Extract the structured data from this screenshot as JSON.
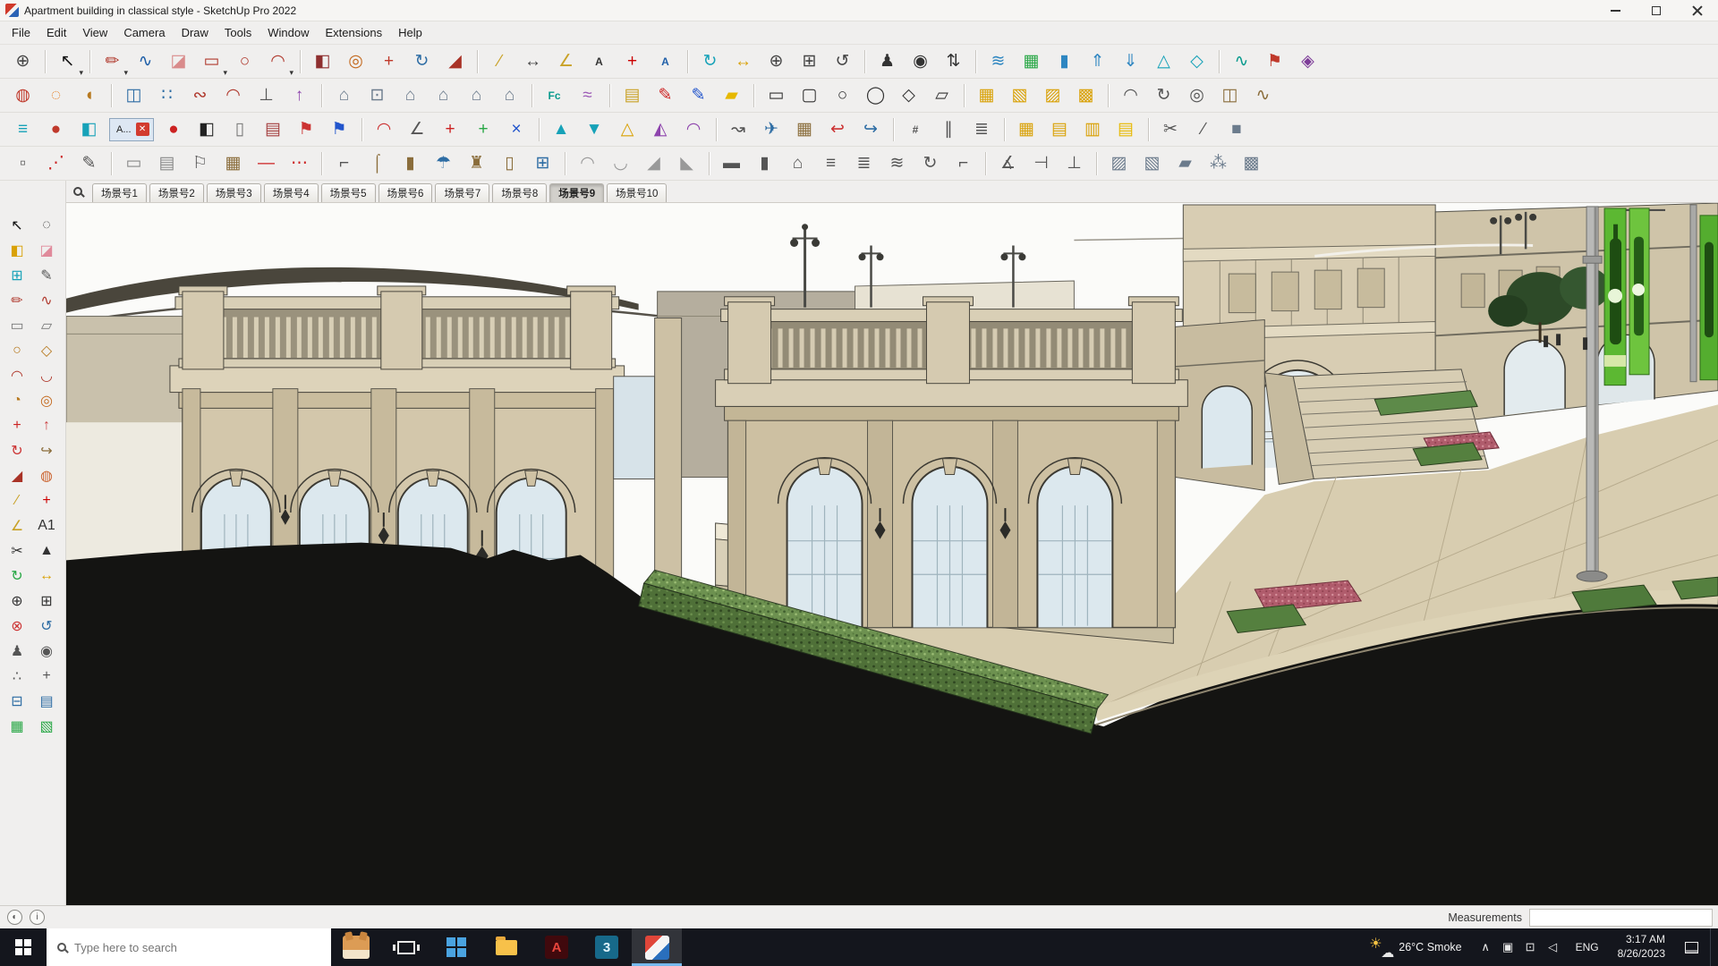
{
  "window": {
    "title": "Apartment building in classical style - SketchUp Pro 2022"
  },
  "glyphs": {
    "dropdown": "▾"
  },
  "colors": {
    "active_accent": "#76b9ed",
    "taskbar_bg": "#14161d"
  },
  "menu": {
    "items": [
      {
        "n": "menu-file",
        "label": "File"
      },
      {
        "n": "menu-edit",
        "label": "Edit"
      },
      {
        "n": "menu-view",
        "label": "View"
      },
      {
        "n": "menu-camera",
        "label": "Camera"
      },
      {
        "n": "menu-draw",
        "label": "Draw"
      },
      {
        "n": "menu-tools",
        "label": "Tools"
      },
      {
        "n": "menu-window",
        "label": "Window"
      },
      {
        "n": "menu-extensions",
        "label": "Extensions"
      },
      {
        "n": "menu-help",
        "label": "Help"
      }
    ]
  },
  "toolbars": {
    "mini_window": {
      "label": "A...",
      "close_glyph": "✕"
    },
    "row1": [
      {
        "n": "zoom-extents-tool",
        "g": "⊕",
        "c": "#444444"
      },
      {
        "sep": true
      },
      {
        "n": "select-tool",
        "g": "↖",
        "c": "#111111",
        "d": true
      },
      {
        "sep": true
      },
      {
        "n": "line-tool",
        "g": "✏",
        "c": "#b03a2e",
        "d": true
      },
      {
        "n": "freehand-tool",
        "g": "∿",
        "c": "#1f5fa8"
      },
      {
        "n": "eraser-tool",
        "g": "◪",
        "c": "#d98b8b"
      },
      {
        "n": "rectangle-tool",
        "g": "▭",
        "c": "#b03a2e",
        "d": true
      },
      {
        "n": "circle-tool",
        "g": "○",
        "c": "#b03a2e"
      },
      {
        "n": "arc-tool",
        "g": "◠",
        "c": "#b03a2e",
        "d": true
      },
      {
        "sep": true
      },
      {
        "n": "push-pull-tool",
        "g": "◧",
        "c": "#8e2f2f"
      },
      {
        "n": "offset-tool",
        "g": "◎",
        "c": "#c46a1f"
      },
      {
        "n": "move-tool",
        "g": "+",
        "c": "#c0392b"
      },
      {
        "n": "rotate-tool",
        "g": "↻",
        "c": "#2e6da4"
      },
      {
        "n": "scale-tool",
        "g": "◢",
        "c": "#a93226"
      },
      {
        "sep": true
      },
      {
        "n": "tape-measure-tool",
        "g": "∕",
        "c": "#c9a227"
      },
      {
        "n": "dimension-tool",
        "g": "↔",
        "c": "#444444"
      },
      {
        "n": "protractor-tool",
        "g": "∠",
        "c": "#c9a227"
      },
      {
        "n": "text-tool",
        "g": "A",
        "c": "#333333",
        "text": true
      },
      {
        "n": "axes-tool",
        "g": "+",
        "c": "#cc0000"
      },
      {
        "n": "3d-text-tool",
        "g": "A",
        "c": "#1f5fa8",
        "text": true
      },
      {
        "sep": true
      },
      {
        "n": "orbit-tool",
        "g": "↻",
        "c": "#17a2b8"
      },
      {
        "n": "pan-tool",
        "g": "↔",
        "c": "#d9a106"
      },
      {
        "n": "zoom-tool",
        "g": "⊕",
        "c": "#444444"
      },
      {
        "n": "zoom-window-tool",
        "g": "⊞",
        "c": "#444444"
      },
      {
        "n": "previous-view-tool",
        "g": "↺",
        "c": "#444444"
      },
      {
        "sep": true
      },
      {
        "n": "position-camera-tool",
        "g": "♟",
        "c": "#333333"
      },
      {
        "n": "look-around-tool",
        "g": "◉",
        "c": "#333333"
      },
      {
        "n": "walk-tool",
        "g": "⇅",
        "c": "#333333"
      },
      {
        "sep": true
      },
      {
        "n": "sandbox-from-contours-tool",
        "g": "≋",
        "c": "#2e86c1"
      },
      {
        "n": "sandbox-from-scratch-tool",
        "g": "▦",
        "c": "#28a745"
      },
      {
        "n": "smoove-tool",
        "g": "▮",
        "c": "#2e86c1"
      },
      {
        "n": "stamp-tool",
        "g": "⇑",
        "c": "#2e86c1"
      },
      {
        "n": "drape-tool",
        "g": "⇓",
        "c": "#2e86c1"
      },
      {
        "n": "add-detail-tool",
        "g": "△",
        "c": "#17a2b8"
      },
      {
        "n": "flip-edge-tool",
        "g": "◇",
        "c": "#17a2b8"
      },
      {
        "sep": true
      },
      {
        "n": "extension-wave-tool",
        "g": "∿",
        "c": "#0a9b8e"
      },
      {
        "n": "extension-flag-tool",
        "g": "⚑",
        "c": "#c0392b"
      },
      {
        "n": "extension-diamond-tool",
        "g": "◈",
        "c": "#7d3c98"
      }
    ],
    "row2": [
      {
        "n": "soap-skin-tool",
        "g": "◍",
        "c": "#c0392b"
      },
      {
        "n": "bubble-tool",
        "g": "◌",
        "c": "#e67e22"
      },
      {
        "n": "round-corner-tool",
        "g": "◖",
        "c": "#b7791f"
      },
      {
        "sep": true
      },
      {
        "n": "mirror-tool",
        "g": "◫",
        "c": "#2e6da4"
      },
      {
        "n": "array-copy-tool",
        "g": "∷",
        "c": "#2e6da4"
      },
      {
        "n": "weld-edges-tool",
        "g": "∾",
        "c": "#b03a2e"
      },
      {
        "n": "bezier-curve-tool",
        "g": "◠",
        "c": "#b03a2e"
      },
      {
        "n": "perpendicular-face-tool",
        "g": "⊥",
        "c": "#555555"
      },
      {
        "n": "extrude-tool",
        "g": "↑",
        "c": "#8e44ad"
      },
      {
        "sep": true
      },
      {
        "n": "iso-view-button",
        "g": "⌂",
        "c": "#6b7b8c"
      },
      {
        "n": "top-view-button",
        "g": "⊡",
        "c": "#6b7b8c"
      },
      {
        "n": "front-view-button",
        "g": "⌂",
        "c": "#6b7b8c"
      },
      {
        "n": "right-view-button",
        "g": "⌂",
        "c": "#6b7b8c"
      },
      {
        "n": "back-view-button",
        "g": "⌂",
        "c": "#6b7b8c"
      },
      {
        "n": "left-view-button",
        "g": "⌂",
        "c": "#6b7b8c"
      },
      {
        "sep": true
      },
      {
        "n": "fredo-scale-tool",
        "g": "Fc",
        "c": "#0a9b8e",
        "text": true
      },
      {
        "n": "curviloft-tool",
        "g": "≈",
        "c": "#9b59b6"
      },
      {
        "sep": true
      },
      {
        "n": "note-tool",
        "g": "▤",
        "c": "#c9a227"
      },
      {
        "n": "red-marker-tool",
        "g": "✎",
        "c": "#cc2222"
      },
      {
        "n": "blue-marker-tool",
        "g": "✎",
        "c": "#2255cc"
      },
      {
        "n": "highlighter-tool",
        "g": "▰",
        "c": "#e6b800"
      },
      {
        "sep": true
      },
      {
        "n": "shape-rectangle-tool",
        "g": "▭",
        "c": "#333333"
      },
      {
        "n": "shape-rounded-rectangle-tool",
        "g": "▢",
        "c": "#333333"
      },
      {
        "n": "shape-circle-tool",
        "g": "○",
        "c": "#333333"
      },
      {
        "n": "shape-ellipse-tool",
        "g": "◯",
        "c": "#333333"
      },
      {
        "n": "shape-polygon-tool",
        "g": "◇",
        "c": "#333333"
      },
      {
        "n": "shape-parallelogram-tool",
        "g": "▱",
        "c": "#333333"
      },
      {
        "sep": true
      },
      {
        "n": "grid-tool",
        "g": "▦",
        "c": "#d9a106"
      },
      {
        "n": "rotated-grid-tool",
        "g": "▧",
        "c": "#d9a106"
      },
      {
        "n": "hatch-tool",
        "g": "▨",
        "c": "#d9a106"
      },
      {
        "n": "solid-grid-tool",
        "g": "▩",
        "c": "#d9a106"
      },
      {
        "sep": true
      },
      {
        "n": "arc-segment-tool",
        "g": "◠",
        "c": "#555555"
      },
      {
        "n": "spiral-tool",
        "g": "↻",
        "c": "#555555"
      },
      {
        "n": "pipe-tool",
        "g": "◎",
        "c": "#555555"
      },
      {
        "n": "lattice-tool",
        "g": "◫",
        "c": "#8a6d3b"
      },
      {
        "n": "zigzag-tool",
        "g": "∿",
        "c": "#8a6d3b"
      }
    ],
    "row3a": [
      {
        "n": "tags-panel-tool",
        "g": "≡",
        "c": "#17a2b8"
      },
      {
        "n": "materials-panel-tool",
        "g": "●",
        "c": "#c0392b"
      },
      {
        "n": "components-panel-tool",
        "g": "◧",
        "c": "#17a2b8"
      }
    ],
    "row3b": [
      {
        "n": "material-sphere-tool",
        "g": "●",
        "c": "#cc2222"
      },
      {
        "n": "bw-display-tool",
        "g": "◧",
        "c": "#222222"
      },
      {
        "n": "white-display-tool",
        "g": "▯",
        "c": "#777777"
      },
      {
        "n": "page-tool",
        "g": "▤",
        "c": "#a33d3d"
      },
      {
        "n": "red-flag-tool",
        "g": "⚑",
        "c": "#cc3333"
      },
      {
        "n": "blue-flag-tool",
        "g": "⚑",
        "c": "#2255cc"
      },
      {
        "sep": true
      },
      {
        "n": "red-arc-tool",
        "g": "◠",
        "c": "#cc3333"
      },
      {
        "n": "angle-tool",
        "g": "∠",
        "c": "#555555"
      },
      {
        "n": "red-plus-tool",
        "g": "+",
        "c": "#cc2222"
      },
      {
        "n": "green-plus-tool",
        "g": "+",
        "c": "#28a745"
      },
      {
        "n": "blue-cross-tool",
        "g": "×",
        "c": "#2255cc"
      },
      {
        "sep": true
      },
      {
        "n": "cone-tool",
        "g": "▲",
        "c": "#17a2b8"
      },
      {
        "n": "drop-tool",
        "g": "▼",
        "c": "#17a2b8"
      },
      {
        "n": "pyramid-tool",
        "g": "△",
        "c": "#d9a106"
      },
      {
        "n": "prism-tool",
        "g": "◭",
        "c": "#8e44ad"
      },
      {
        "n": "dome-tool",
        "g": "◠",
        "c": "#8e44ad"
      },
      {
        "sep": true
      },
      {
        "n": "follow-path-tool",
        "g": "↝",
        "c": "#555555"
      },
      {
        "n": "airplane-tool",
        "g": "✈",
        "c": "#2e6da4"
      },
      {
        "n": "crate-tool",
        "g": "▦",
        "c": "#8a6d3b"
      },
      {
        "n": "undo-arc-tool",
        "g": "↩",
        "c": "#cc3333"
      },
      {
        "n": "redo-arc-tool",
        "g": "↪",
        "c": "#2e6da4"
      },
      {
        "sep": true
      },
      {
        "n": "fence-tool",
        "g": "#",
        "c": "#555555",
        "text": true
      },
      {
        "n": "railing-tool",
        "g": "∥",
        "c": "#555555"
      },
      {
        "n": "escalator-tool",
        "g": "≣",
        "c": "#555555"
      },
      {
        "sep": true
      },
      {
        "n": "table-grid-tool",
        "g": "▦",
        "c": "#d9a106"
      },
      {
        "n": "table-cells-tool",
        "g": "▤",
        "c": "#d9a106"
      },
      {
        "n": "table-columns-tool",
        "g": "▥",
        "c": "#d9a106"
      },
      {
        "n": "table-rows-tool",
        "g": "▤",
        "c": "#e6b800"
      },
      {
        "sep": true
      },
      {
        "n": "scissors-tool",
        "g": "✂",
        "c": "#555555"
      },
      {
        "n": "knife-tool",
        "g": "∕",
        "c": "#555555"
      },
      {
        "n": "solid-box-tool",
        "g": "■",
        "c": "#6b7b8c"
      }
    ],
    "row4": [
      {
        "n": "cube-frame-tool",
        "g": "▫",
        "c": "#555555"
      },
      {
        "n": "dotted-path-tool",
        "g": "⋰",
        "c": "#cc2222"
      },
      {
        "n": "pencil-edit-tool",
        "g": "✎",
        "c": "#555555"
      },
      {
        "sep": true
      },
      {
        "n": "panel-tool",
        "g": "▭",
        "c": "#888888"
      },
      {
        "n": "panel-lines-tool",
        "g": "▤",
        "c": "#888888"
      },
      {
        "n": "outline-flag-tool",
        "g": "⚐",
        "c": "#555555"
      },
      {
        "n": "wood-box-tool",
        "g": "▦",
        "c": "#8a6d3b"
      },
      {
        "n": "red-line-tool",
        "g": "―",
        "c": "#cc2222"
      },
      {
        "n": "dots-tool",
        "g": "⋯",
        "c": "#cc2222"
      },
      {
        "sep": true
      },
      {
        "n": "profile-tool",
        "g": "⌐",
        "c": "#555555"
      },
      {
        "n": "molding-tool",
        "g": "⌠",
        "c": "#8a6d3b"
      },
      {
        "n": "column-tool",
        "g": "▮",
        "c": "#8a6d3b"
      },
      {
        "n": "umbrella-tool",
        "g": "☂",
        "c": "#2e6da4"
      },
      {
        "n": "furniture-tool",
        "g": "♜",
        "c": "#8a6d3b"
      },
      {
        "n": "door-tool",
        "g": "▯",
        "c": "#8a6d3b"
      },
      {
        "n": "window-tool",
        "g": "⊞",
        "c": "#2e6da4"
      },
      {
        "sep": true
      },
      {
        "n": "fan-up-tool",
        "g": "◠",
        "c": "#999999"
      },
      {
        "n": "fan-down-tool",
        "g": "◡",
        "c": "#999999"
      },
      {
        "n": "slope-tool",
        "g": "◢",
        "c": "#999999"
      },
      {
        "n": "ramp-tool",
        "g": "◣",
        "c": "#999999"
      },
      {
        "sep": true
      },
      {
        "n": "floor-tool",
        "g": "▬",
        "c": "#555555"
      },
      {
        "n": "wall-tool",
        "g": "▮",
        "c": "#555555"
      },
      {
        "n": "roof-tool",
        "g": "⌂",
        "c": "#555555"
      },
      {
        "n": "straight-stair-tool",
        "g": "≡",
        "c": "#555555"
      },
      {
        "n": "l-stair-tool",
        "g": "≣",
        "c": "#555555"
      },
      {
        "n": "u-stair-tool",
        "g": "≋",
        "c": "#555555"
      },
      {
        "n": "spiral-stair-tool",
        "g": "↻",
        "c": "#555555"
      },
      {
        "n": "handrail-tool",
        "g": "⌐",
        "c": "#555555"
      },
      {
        "sep": true
      },
      {
        "n": "angle-measure-tool",
        "g": "∡",
        "c": "#555555"
      },
      {
        "n": "level-tool",
        "g": "⊣",
        "c": "#555555"
      },
      {
        "n": "plumb-tool",
        "g": "⊥",
        "c": "#555555"
      },
      {
        "sep": true
      },
      {
        "n": "texture-tool",
        "g": "▨",
        "c": "#6b7b8c"
      },
      {
        "n": "material-box-tool",
        "g": "▧",
        "c": "#6b7b8c"
      },
      {
        "n": "paint-roller-tool",
        "g": "▰",
        "c": "#6b7b8c"
      },
      {
        "n": "spray-tool",
        "g": "⁂",
        "c": "#6b7b8c"
      },
      {
        "n": "pattern-tool",
        "g": "▩",
        "c": "#6b7b8c"
      }
    ]
  },
  "left_palette": [
    {
      "n": "select-tool",
      "g": "↖",
      "c": "#111111"
    },
    {
      "n": "lasso-select-tool",
      "g": "◌",
      "c": "#333333"
    },
    {
      "n": "paint-bucket-tool",
      "g": "◧",
      "c": "#d9a106"
    },
    {
      "n": "eraser-tool",
      "g": "◪",
      "c": "#e08a9b"
    },
    {
      "n": "make-component-tool",
      "g": "⊞",
      "c": "#17a2b8"
    },
    {
      "n": "pencil-tool",
      "g": "✎",
      "c": "#555555"
    },
    {
      "n": "line-tool",
      "g": "✏",
      "c": "#b03a2e"
    },
    {
      "n": "freehand-tool",
      "g": "∿",
      "c": "#b03a2e"
    },
    {
      "n": "rectangle-tool",
      "g": "▭",
      "c": "#777777"
    },
    {
      "n": "rotated-rectangle-tool",
      "g": "▱",
      "c": "#777777"
    },
    {
      "n": "circle-tool",
      "g": "○",
      "c": "#b7791f"
    },
    {
      "n": "polygon-tool",
      "g": "◇",
      "c": "#b7791f"
    },
    {
      "n": "arc-tool",
      "g": "◠",
      "c": "#b03a2e"
    },
    {
      "n": "two-point-arc-tool",
      "g": "◡",
      "c": "#b03a2e"
    },
    {
      "n": "pie-tool",
      "g": "◔",
      "c": "#b7791f"
    },
    {
      "n": "offset-tool",
      "g": "◎",
      "c": "#c46a1f"
    },
    {
      "n": "move-tool",
      "g": "+",
      "c": "#cc2222"
    },
    {
      "n": "push-pull-tool",
      "g": "↑",
      "c": "#cc4444"
    },
    {
      "n": "rotate-tool",
      "g": "↻",
      "c": "#cc3333"
    },
    {
      "n": "follow-me-tool",
      "g": "↪",
      "c": "#8a6d3b"
    },
    {
      "n": "scale-tool",
      "g": "◢",
      "c": "#a93226"
    },
    {
      "n": "outer-shell-tool",
      "g": "◍",
      "c": "#cc6633"
    },
    {
      "n": "tape-measure-tool",
      "g": "∕",
      "c": "#c9a227"
    },
    {
      "n": "axes-tool",
      "g": "+",
      "c": "#cc0000"
    },
    {
      "n": "protractor-tool",
      "g": "∠",
      "c": "#c9a227"
    },
    {
      "n": "text-tool",
      "g": "A1",
      "c": "#333333",
      "text": true
    },
    {
      "n": "section-cut-tool",
      "g": "✂",
      "c": "#333333"
    },
    {
      "n": "3d-text-tool",
      "g": "▲",
      "c": "#333333"
    },
    {
      "n": "orbit-tool",
      "g": "↻",
      "c": "#28a745"
    },
    {
      "n": "pan-tool",
      "g": "↔",
      "c": "#d9a106"
    },
    {
      "n": "zoom-tool",
      "g": "⊕",
      "c": "#333333"
    },
    {
      "n": "zoom-window-tool",
      "g": "⊞",
      "c": "#333333"
    },
    {
      "n": "zoom-extents-tool",
      "g": "⊗",
      "c": "#cc3333"
    },
    {
      "n": "previous-view-tool",
      "g": "↺",
      "c": "#2e6da4"
    },
    {
      "n": "position-camera-tool",
      "g": "♟",
      "c": "#555555"
    },
    {
      "n": "look-around-tool",
      "g": "◉",
      "c": "#555555"
    },
    {
      "n": "walk-tool",
      "g": "∴",
      "c": "#555555"
    },
    {
      "n": "turn-around-tool",
      "g": "+",
      "c": "#555555"
    },
    {
      "n": "section-plane-tool",
      "g": "⊟",
      "c": "#2e6da4"
    },
    {
      "n": "section-display-tool",
      "g": "▤",
      "c": "#2e6da4"
    },
    {
      "n": "section-fill-tool",
      "g": "▦",
      "c": "#28a745"
    },
    {
      "n": "section-outline-tool",
      "g": "▧",
      "c": "#28a745"
    }
  ],
  "scene_bar": {
    "tabs": [
      {
        "n": "scene-tab-1",
        "label": "场景号1"
      },
      {
        "n": "scene-tab-2",
        "label": "场景号2"
      },
      {
        "n": "scene-tab-3",
        "label": "场景号3"
      },
      {
        "n": "scene-tab-4",
        "label": "场景号4"
      },
      {
        "n": "scene-tab-5",
        "label": "场景号5"
      },
      {
        "n": "scene-tab-6",
        "label": "场景号6"
      },
      {
        "n": "scene-tab-7",
        "label": "场景号7"
      },
      {
        "n": "scene-tab-8",
        "label": "场景号8"
      },
      {
        "n": "scene-tab-9",
        "label": "场景号9",
        "active": true
      },
      {
        "n": "scene-tab-10",
        "label": "场景号10"
      }
    ]
  },
  "statusbar": {
    "geolocation_glyph": "◐",
    "credits_glyph": "i",
    "measurements_label": "Measurements",
    "measurements_value": ""
  },
  "taskbar": {
    "search_placeholder": "Type here to search",
    "weather_temp": "26°C",
    "weather_condition": "Smoke",
    "language": "ENG",
    "time": "3:17 AM",
    "date": "8/26/2023",
    "tray": [
      {
        "n": "hidden-icons-chevron",
        "g": "∧"
      },
      {
        "n": "tray-app-icon",
        "g": "▣"
      },
      {
        "n": "ethernet-icon",
        "g": "⊡"
      },
      {
        "n": "volume-icon",
        "g": "◁"
      }
    ]
  }
}
